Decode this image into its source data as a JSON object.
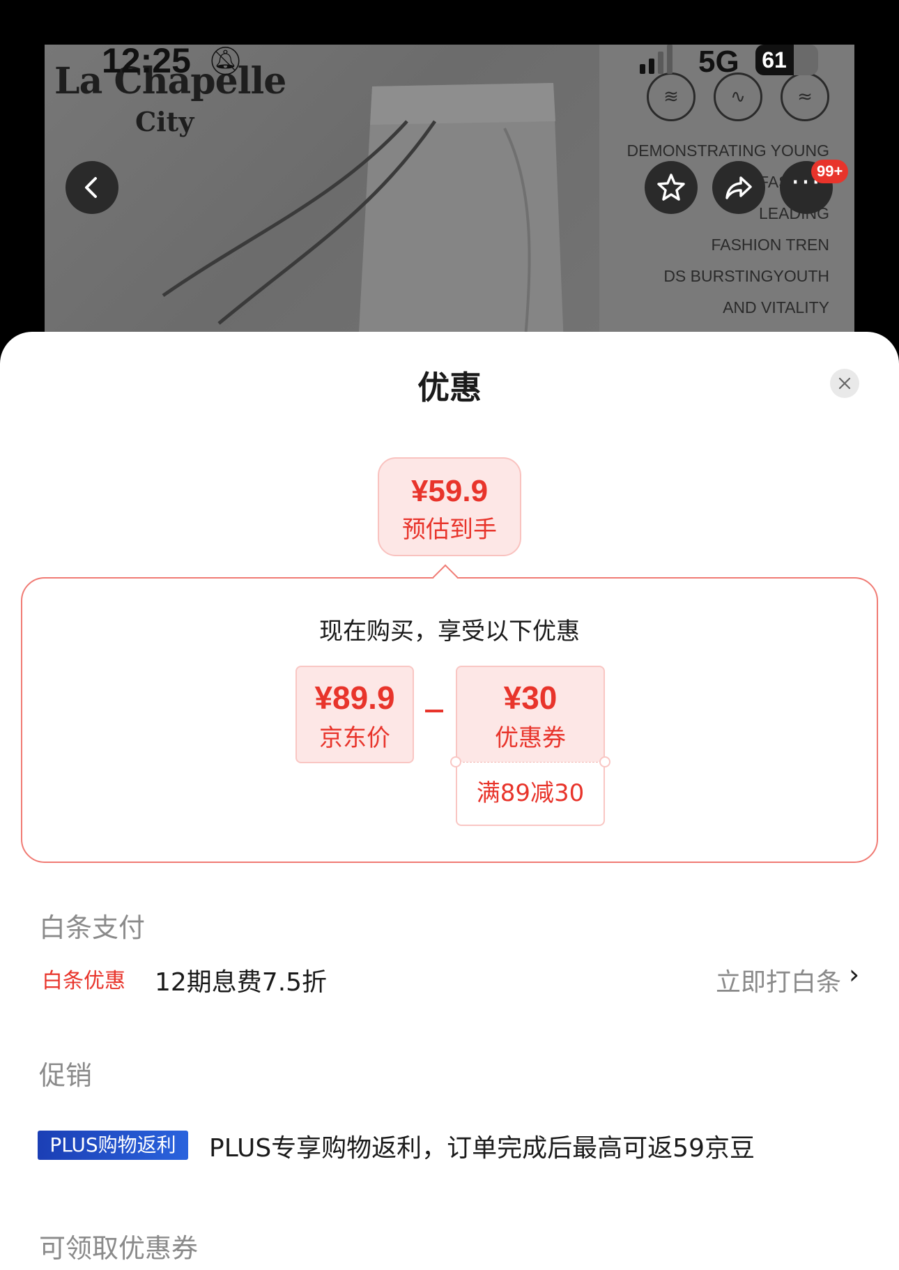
{
  "status_bar": {
    "time": "12:25",
    "network": "5G",
    "battery_level": "61",
    "battery_fraction": 0.61
  },
  "hero": {
    "brand_name": "La Chapelle",
    "brand_sub": "City",
    "slogan_lines": [
      "DEMONSTRATING YOUNG",
      "NEW FASHION",
      "LEADING",
      "FASHION TREN",
      "DS BURSTINGYOUTH",
      "AND VITALITY"
    ]
  },
  "nav": {
    "badge": "99+"
  },
  "sheet": {
    "title": "优惠",
    "estimate": {
      "price": "¥59.9",
      "label": "预估到手"
    },
    "discount": {
      "heading": "现在购买，享受以下优惠",
      "jd_price": "¥89.9",
      "jd_label": "京东价",
      "coupon_value": "¥30",
      "coupon_label": "优惠券",
      "coupon_condition": "满89减30"
    },
    "baitiao": {
      "section": "白条支付",
      "tag": "白条优惠",
      "text": "12期息费7.5折",
      "action": "立即打白条"
    },
    "promo": {
      "section": "促销",
      "tag": "PLUS购物返利",
      "text": "PLUS专享购物返利，订单完成后最高可返59京豆"
    },
    "coupons": {
      "section": "可领取优惠券"
    }
  },
  "colors": {
    "accent_red": "#e8342b",
    "plus_blue": "#1b3fb5"
  }
}
